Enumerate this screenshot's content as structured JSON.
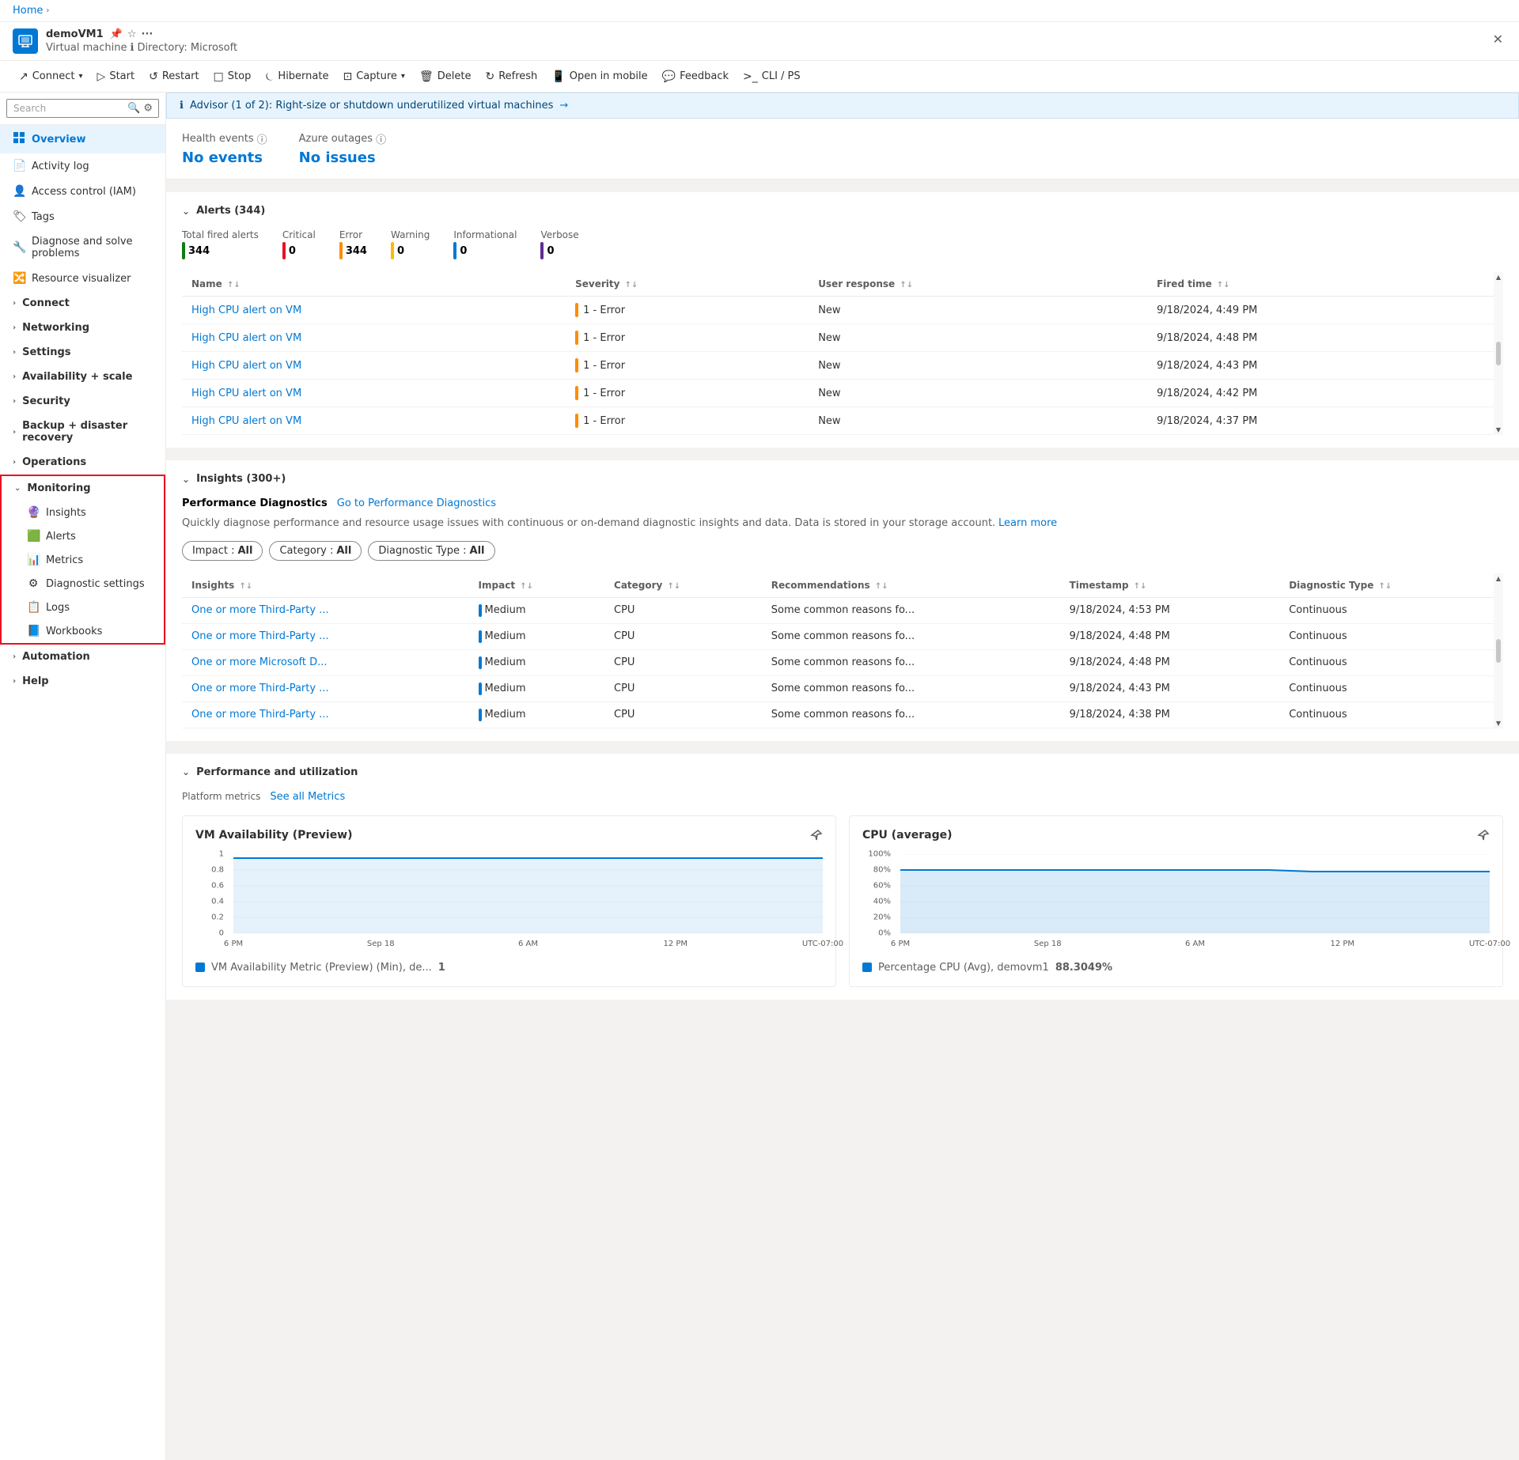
{
  "breadcrumb": {
    "home": "Home",
    "chevron": "›"
  },
  "vm": {
    "icon": "💻",
    "name": "demoVM1",
    "subtitle": "Virtual machine",
    "directory_label": "Directory: Microsoft",
    "info_icon": "ℹ"
  },
  "toolbar": {
    "connect": "Connect",
    "start": "Start",
    "restart": "Restart",
    "stop": "Stop",
    "hibernate": "Hibernate",
    "capture": "Capture",
    "delete": "Delete",
    "refresh": "Refresh",
    "open_mobile": "Open in mobile",
    "feedback": "Feedback",
    "cli_ps": "CLI / PS"
  },
  "sidebar": {
    "search_placeholder": "Search",
    "overview": "Overview",
    "activity_log": "Activity log",
    "access_control": "Access control (IAM)",
    "tags": "Tags",
    "diagnose": "Diagnose and solve problems",
    "resource_visualizer": "Resource visualizer",
    "connect": "Connect",
    "networking": "Networking",
    "settings": "Settings",
    "availability": "Availability + scale",
    "security": "Security",
    "backup": "Backup + disaster recovery",
    "operations": "Operations",
    "monitoring": "Monitoring",
    "monitoring_items": [
      {
        "id": "insights",
        "label": "Insights",
        "icon": "🔮"
      },
      {
        "id": "alerts",
        "label": "Alerts",
        "icon": "🟩"
      },
      {
        "id": "metrics",
        "label": "Metrics",
        "icon": "📊"
      },
      {
        "id": "diagnostic_settings",
        "label": "Diagnostic settings",
        "icon": "⚙"
      },
      {
        "id": "logs",
        "label": "Logs",
        "icon": "📋"
      },
      {
        "id": "workbooks",
        "label": "Workbooks",
        "icon": "📘"
      }
    ],
    "automation": "Automation",
    "help": "Help"
  },
  "advisor_banner": {
    "icon": "ℹ",
    "text": "Advisor (1 of 2): Right-size or shutdown underutilized virtual machines",
    "arrow": "→"
  },
  "health": {
    "events_label": "Health events",
    "events_value": "No events",
    "outages_label": "Azure outages",
    "outages_value": "No issues",
    "info_icon": "ⓘ"
  },
  "alerts": {
    "section_title": "Alerts (344)",
    "stats": [
      {
        "label": "Total fired alerts",
        "value": "344",
        "bar_class": "bar-green",
        "color": "#107c10"
      },
      {
        "label": "Critical",
        "value": "0",
        "bar_class": "bar-red",
        "color": "#e81123"
      },
      {
        "label": "Error",
        "value": "344",
        "bar_class": "bar-orange",
        "color": "#ff8c00"
      },
      {
        "label": "Warning",
        "value": "0",
        "bar_class": "bar-yellow",
        "color": "#ffb900"
      },
      {
        "label": "Informational",
        "value": "0",
        "bar_class": "bar-blue",
        "color": "#0078d4"
      },
      {
        "label": "Verbose",
        "value": "0",
        "bar_class": "bar-purple",
        "color": "#5c2d91"
      }
    ],
    "columns": [
      {
        "label": "Name",
        "sort": "↑↓"
      },
      {
        "label": "Severity",
        "sort": "↑↓"
      },
      {
        "label": "User response",
        "sort": "↑↓"
      },
      {
        "label": "Fired time",
        "sort": "↑↓"
      }
    ],
    "rows": [
      {
        "name": "High CPU alert on VM",
        "severity": "1 - Error",
        "sev_color": "#ff8c00",
        "user_response": "New",
        "fired_time": "9/18/2024, 4:49 PM"
      },
      {
        "name": "High CPU alert on VM",
        "severity": "1 - Error",
        "sev_color": "#ff8c00",
        "user_response": "New",
        "fired_time": "9/18/2024, 4:48 PM"
      },
      {
        "name": "High CPU alert on VM",
        "severity": "1 - Error",
        "sev_color": "#ff8c00",
        "user_response": "New",
        "fired_time": "9/18/2024, 4:43 PM"
      },
      {
        "name": "High CPU alert on VM",
        "severity": "1 - Error",
        "sev_color": "#ff8c00",
        "user_response": "New",
        "fired_time": "9/18/2024, 4:42 PM"
      },
      {
        "name": "High CPU alert on VM",
        "severity": "1 - Error",
        "sev_color": "#ff8c00",
        "user_response": "New",
        "fired_time": "9/18/2024, 4:37 PM"
      }
    ]
  },
  "insights": {
    "section_title": "Insights (300+)",
    "perf_diag_label": "Performance Diagnostics",
    "perf_diag_link": "Go to Performance Diagnostics",
    "perf_diag_desc": "Quickly diagnose performance and resource usage issues with continuous or on-demand diagnostic insights and data. Data is stored in your storage account.",
    "learn_more": "Learn more",
    "filters": [
      {
        "label": "Impact : ",
        "value": "All"
      },
      {
        "label": "Category : ",
        "value": "All"
      },
      {
        "label": "Diagnostic Type : ",
        "value": "All"
      }
    ],
    "columns": [
      {
        "label": "Insights",
        "sort": "↑↓"
      },
      {
        "label": "Impact",
        "sort": "↑↓"
      },
      {
        "label": "Category",
        "sort": "↑↓"
      },
      {
        "label": "Recommendations",
        "sort": "↑↓"
      },
      {
        "label": "Timestamp",
        "sort": "↑↓"
      },
      {
        "label": "Diagnostic Type",
        "sort": "↑↓"
      }
    ],
    "rows": [
      {
        "insight": "One or more Third-Party ...",
        "impact": "Medium",
        "impact_color": "#0078d4",
        "category": "CPU",
        "recommendations": "Some common reasons fo...",
        "timestamp": "9/18/2024, 4:53 PM",
        "diag_type": "Continuous"
      },
      {
        "insight": "One or more Third-Party ...",
        "impact": "Medium",
        "impact_color": "#0078d4",
        "category": "CPU",
        "recommendations": "Some common reasons fo...",
        "timestamp": "9/18/2024, 4:48 PM",
        "diag_type": "Continuous"
      },
      {
        "insight": "One or more Microsoft D...",
        "impact": "Medium",
        "impact_color": "#0078d4",
        "category": "CPU",
        "recommendations": "Some common reasons fo...",
        "timestamp": "9/18/2024, 4:48 PM",
        "diag_type": "Continuous"
      },
      {
        "insight": "One or more Third-Party ...",
        "impact": "Medium",
        "impact_color": "#0078d4",
        "category": "CPU",
        "recommendations": "Some common reasons fo...",
        "timestamp": "9/18/2024, 4:43 PM",
        "diag_type": "Continuous"
      },
      {
        "insight": "One or more Third-Party ...",
        "impact": "Medium",
        "impact_color": "#0078d4",
        "category": "CPU",
        "recommendations": "Some common reasons fo...",
        "timestamp": "9/18/2024, 4:38 PM",
        "diag_type": "Continuous"
      }
    ]
  },
  "performance": {
    "section_title": "Performance and utilization",
    "platform_metrics_label": "Platform metrics",
    "see_all_label": "See all Metrics",
    "charts": [
      {
        "id": "vm_availability",
        "title": "VM Availability (Preview)",
        "legend_color": "#0078d4",
        "legend_label": "VM Availability Metric (Preview) (Min), de...",
        "legend_value": "1",
        "y_labels": [
          "1",
          "0.8",
          "0.6",
          "0.4",
          "0.2",
          "0"
        ],
        "x_labels": [
          "6 PM",
          "Sep 18",
          "6 AM",
          "12 PM",
          "UTC-07:00"
        ],
        "line_data": "M0,8 L380,8",
        "line_color": "#0078d4"
      },
      {
        "id": "cpu_average",
        "title": "CPU (average)",
        "legend_color": "#0078d4",
        "legend_label": "Percentage CPU (Avg), demovm1",
        "legend_value": "88.3049%",
        "y_labels": [
          "100%",
          "80%",
          "60%",
          "40%",
          "20%",
          "0%"
        ],
        "x_labels": [
          "6 PM",
          "Sep 18",
          "6 AM",
          "12 PM",
          "UTC-07:00"
        ],
        "line_data": "M0,20 L250,20 L260,22 L380,22",
        "line_color": "#0078d4"
      }
    ]
  },
  "icons": {
    "chevron_right": "›",
    "chevron_down": "⌄",
    "chevron_up": "⌃",
    "sort": "⇅",
    "close": "✕",
    "pin": "📌",
    "info": "ℹ",
    "star": "☆",
    "ellipsis": "···",
    "connect_icon": "↗",
    "start_icon": "▷",
    "restart_icon": "↺",
    "stop_icon": "□",
    "hibernate_icon": "⏾",
    "capture_icon": "⊡",
    "delete_icon": "🗑",
    "refresh_icon": "↻",
    "mobile_icon": "📱",
    "feedback_icon": "💬",
    "cli_icon": ">_",
    "search_icon": "🔍"
  }
}
